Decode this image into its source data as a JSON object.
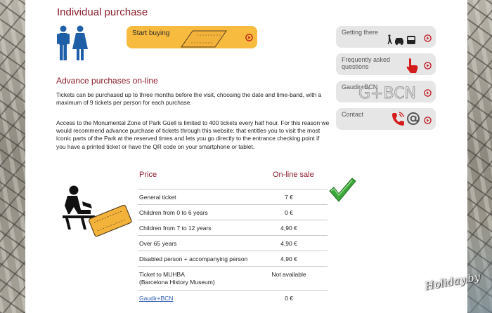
{
  "header": {
    "title": "Individual purchase"
  },
  "buy": {
    "label": "Start buying"
  },
  "advance": {
    "title": "Advance purchases on-line",
    "p1": "Tickets can be purchased up to three months before the visit, choosing the date and time-band, with a maximum of 9 tickets per person for each purchase.",
    "p2": "Access to the Monumental Zone of Park Güell is limited to 400 tickets every half hour. For this reason we would recommend advance purchase of tickets through this website: that entitles you to visit the most iconic parts of the Park at the reserved times and lets you go directly to the entrance checking point if you have a printed ticket or have the QR code on your smartphone or tablet."
  },
  "sidebar": {
    "getting_there": "Getting there",
    "faq": "Frequently asked questions",
    "gaudir": "Gaudir+BCN",
    "contact": "Contact"
  },
  "prices": {
    "col_price": "Price",
    "col_online": "On-line sale",
    "rows": [
      {
        "name": "General ticket",
        "value": "7 €"
      },
      {
        "name": "Children from 0 to 6 years",
        "value": "0 €"
      },
      {
        "name": "Children from 7 to 12 years",
        "value": "4,90 €"
      },
      {
        "name": "Over 65 years",
        "value": "4,90 €"
      },
      {
        "name": "Disabled person  + accompanying person",
        "value": "4,90 €"
      },
      {
        "name": "Ticket to MUHBA\n(Barcelona History Museum)",
        "value": "Not available"
      },
      {
        "name": "Gaudir+BCN",
        "value": "0 €"
      }
    ]
  },
  "watermark": "Holiday.by",
  "colors": {
    "accent": "#8a1c2b",
    "button": "#f7bb3f",
    "sidebar": "#e6e6e6",
    "check": "#3ca83c"
  }
}
